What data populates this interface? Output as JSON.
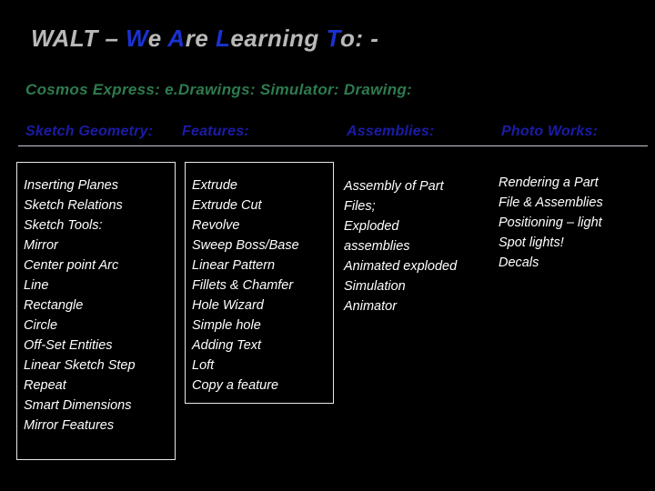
{
  "slide": {
    "background_color": "#000000",
    "title": {
      "segments": [
        {
          "text": "WALT – ",
          "color": "#b9b9b9"
        },
        {
          "text": "W",
          "color": "#1a32d2"
        },
        {
          "text": "e ",
          "color": "#b9b9b9"
        },
        {
          "text": "A",
          "color": "#1a32d2"
        },
        {
          "text": "re ",
          "color": "#b9b9b9"
        },
        {
          "text": "L",
          "color": "#1a32d2"
        },
        {
          "text": "earning ",
          "color": "#b9b9b9"
        },
        {
          "text": "T",
          "color": "#1a32d2"
        },
        {
          "text": "o: -",
          "color": "#b9b9b9"
        }
      ],
      "plain": "WALT – We Are Learning To: -"
    },
    "subtitle": {
      "text": "Cosmos Express:  e.Drawings:  Simulator:  Drawing:",
      "color": "#2e7b4f"
    },
    "header_color": "#1b1ba8",
    "rule_color": "#c8c8d8",
    "columns": [
      {
        "header": "Sketch Geometry:",
        "boxed": true,
        "items": [
          "Inserting Planes",
          "Sketch Relations",
          "Sketch Tools:",
          "Mirror",
          "Center point Arc",
          "Line",
          "Rectangle",
          "Circle",
          "Off-Set Entities",
          "Linear Sketch Step",
          "Repeat",
          "Smart Dimensions",
          "Mirror Features"
        ]
      },
      {
        "header": "Features:",
        "boxed": true,
        "items": [
          "Extrude",
          "Extrude Cut",
          "Revolve",
          "Sweep Boss/Base",
          "Linear Pattern",
          "Fillets & Chamfer",
          "Hole Wizard",
          "Simple hole",
          "Adding Text",
          "Loft",
          "Copy a feature"
        ]
      },
      {
        "header": "Assemblies:",
        "boxed": false,
        "items": [
          "Assembly of Part",
          "Files;",
          "Exploded",
          "assemblies",
          "Animated exploded",
          "Simulation",
          "Animator"
        ]
      },
      {
        "header": "Photo Works:",
        "boxed": false,
        "items": [
          "Rendering a Part",
          "File & Assemblies",
          "Positioning – light",
          "Spot lights!",
          "Decals"
        ]
      }
    ]
  }
}
